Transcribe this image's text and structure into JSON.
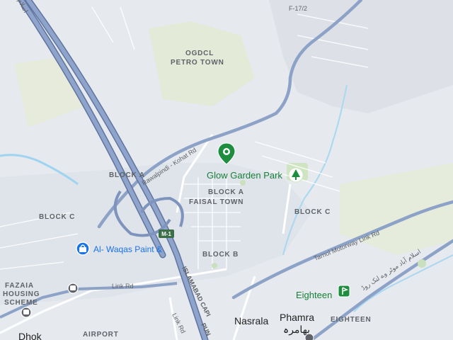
{
  "map": {
    "labels": {
      "f17": "F-17/2",
      "ogdcl_1": "OGDCL",
      "ogdcl_2": "PETRO TOWN",
      "glow_garden": "Glow Garden Park",
      "block_a_left": "BLOCK A",
      "block_a_center": "BLOCK A",
      "faisal_town": "FAISAL TOWN",
      "block_c_right": "BLOCK C",
      "block_c_left": "BLOCK C",
      "block_b": "BLOCK B",
      "al_waqas": "Al- Waqas Paint &",
      "fazaia_1": "FAZAIA",
      "fazaia_2": "HOUSING",
      "fazaia_3": "SCHEME",
      "link_rd": "Link Rd",
      "link_rd_2": "Link Rd",
      "rawalpindi_kohat": "Rawalpindi - Kohat Rd",
      "tarnol_link": "Tarnol Motorway Link Rd",
      "urdu_road": "اسلام آباد موٹر وے لنک روڈ",
      "m1_shield": "M-1",
      "islamabad_cap": "ISLAMABAD CAPI",
      "islamabad_cap_2": "PUN",
      "eighteen_poi": "Eighteen",
      "eighteen_area": "EIGHTEEN",
      "nasrala": "Nasrala",
      "phamra": "Phamra",
      "phamra_urdu": "پھامرہ",
      "dhok": "Dhok",
      "airport": "AIRPORT",
      "top_left_partial": "اسلام"
    },
    "colors": {
      "land": "#e8eaed",
      "park": "#d4e8c8",
      "highway": "#7b8fb5",
      "highway_edge": "#5f74a0",
      "water": "#9fd4f0",
      "green_pin": "#1e8e3e",
      "blue_pin": "#1a73e8"
    }
  }
}
